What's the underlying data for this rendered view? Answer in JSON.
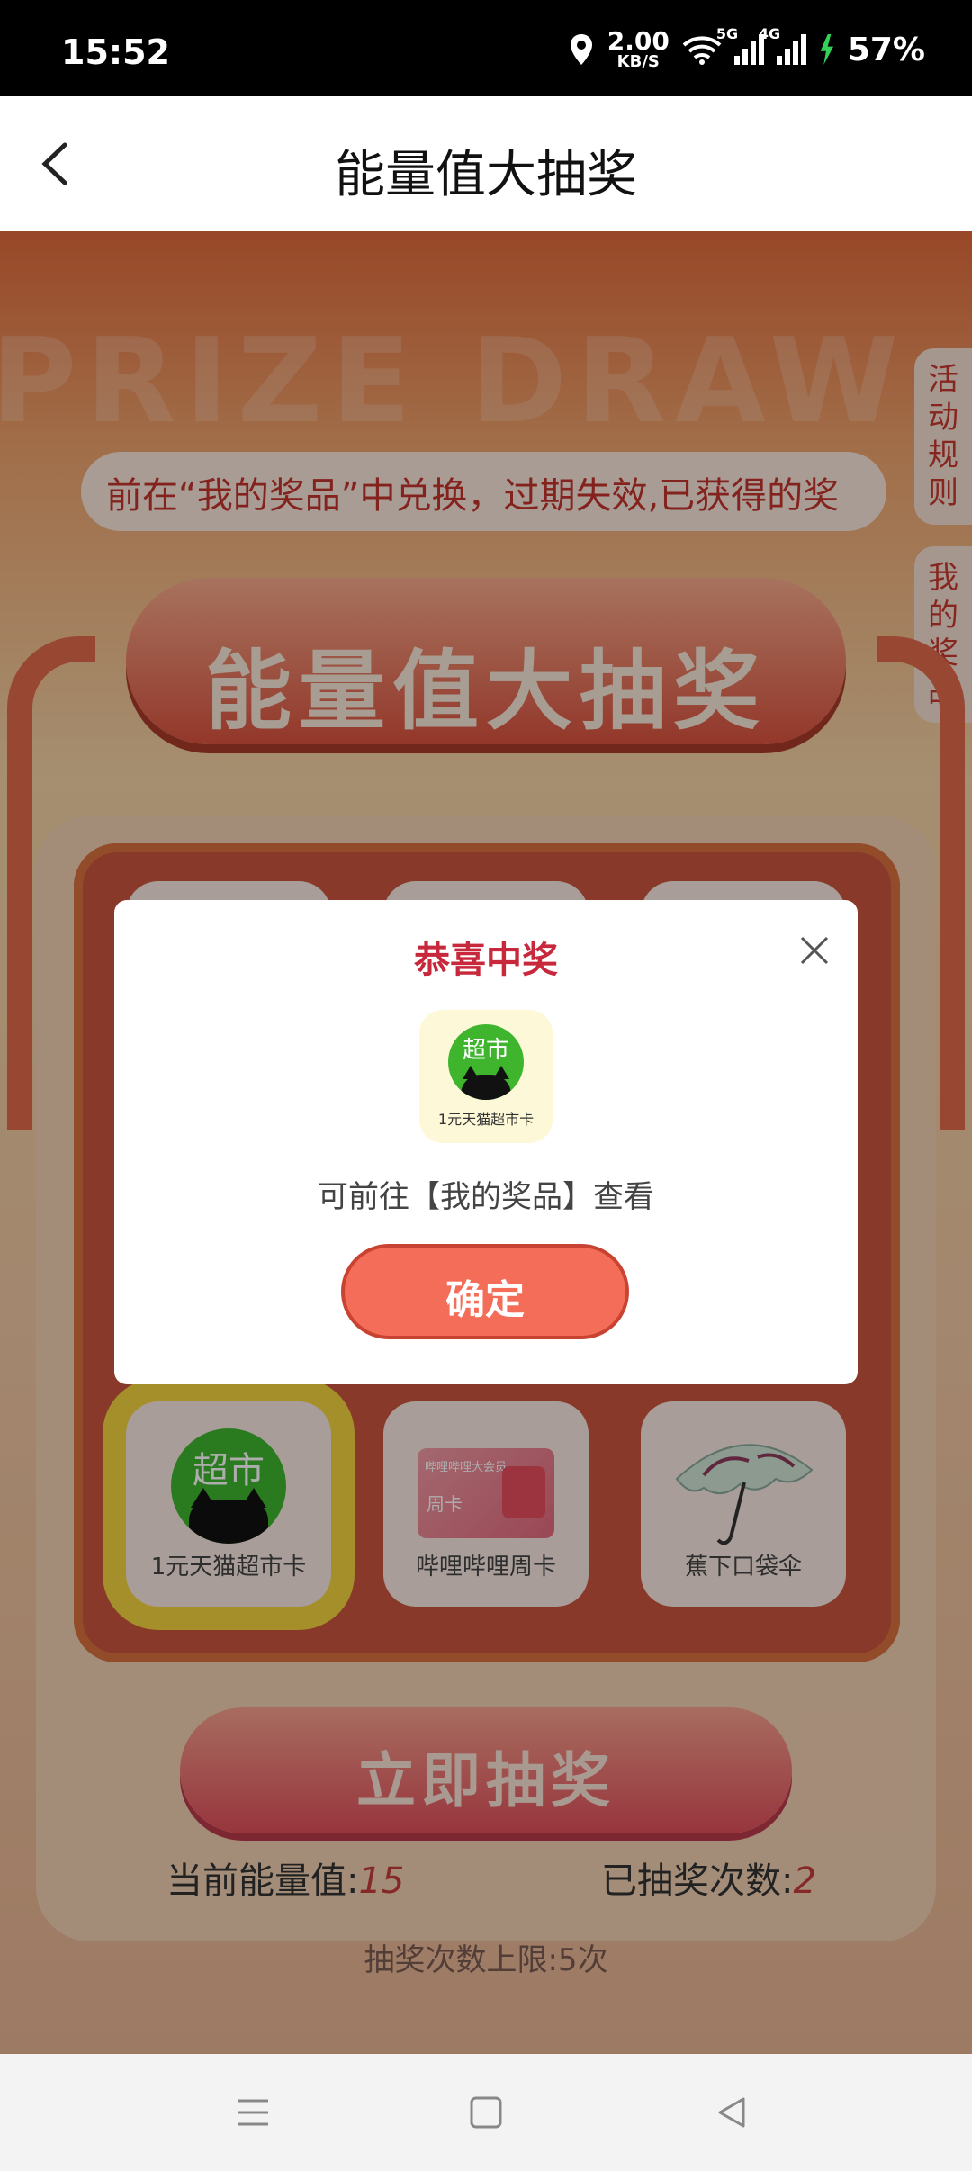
{
  "status_bar": {
    "time": "15:52",
    "speed_value": "2.00",
    "speed_unit": "KB/S",
    "signal1": "5G",
    "signal2": "4G",
    "battery": "57%"
  },
  "header": {
    "title": "能量值大抽奖"
  },
  "main": {
    "marquee": "前在“我的奖品”中兑换，过期失效,已获得的奖",
    "side_tabs": {
      "rules": "活动规则",
      "my_prizes": "我的奖品"
    },
    "banner_title": "能量值大抽奖",
    "prizes": [
      {
        "label": "1元天猫超市卡",
        "icon_text": "超市"
      },
      {
        "label": "哔哩哔哩周卡",
        "card_title": "哔哩哔哩大会员",
        "card_sub": "周卡"
      },
      {
        "label": "蕉下口袋伞"
      }
    ],
    "draw_button": "立即抽奖",
    "energy_label": "当前能量值:",
    "energy_value": "15",
    "draw_count_label": "已抽奖次数:",
    "draw_count_value": "2",
    "limit_text": "抽奖次数上限:5次"
  },
  "modal": {
    "title": "恭喜中奖",
    "prize_icon_text": "超市",
    "prize_label": "1元天猫超市卡",
    "hint": "可前往【我的奖品】查看",
    "confirm": "确定"
  },
  "colors": {
    "accent": "#f46d58",
    "title_red": "#c8283b",
    "highlight": "#f2d33f"
  }
}
